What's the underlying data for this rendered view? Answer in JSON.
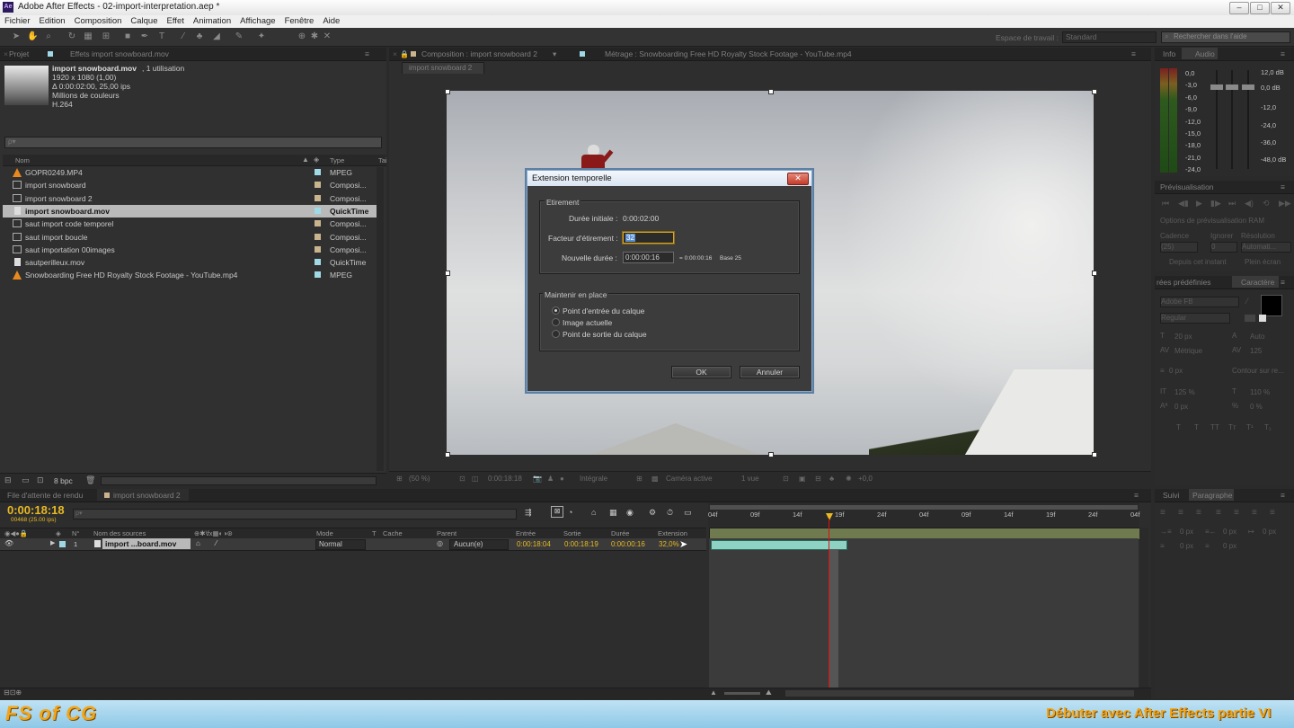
{
  "window": {
    "title": "Adobe After Effects - 02-import-interpretation.aep *",
    "logo": "Ae",
    "min": "–",
    "max": "□",
    "close": "✕"
  },
  "menu": [
    "Fichier",
    "Edition",
    "Composition",
    "Calque",
    "Effet",
    "Animation",
    "Affichage",
    "Fenêtre",
    "Aide"
  ],
  "toolbar": {
    "workspace_label": "Espace de travail :",
    "workspace_value": "Standard",
    "search_placeholder": "Rechercher dans l'aide"
  },
  "project_panel": {
    "tab_project": "Projet",
    "tab_effects": "Effets import snowboard.mov",
    "selected": {
      "name": "import snowboard.mov",
      "usage": ", 1 utilisation",
      "dims": "1920 x 1080 (1,00)",
      "duration": "Δ 0:00:02:00, 25,00 ips",
      "colors": "Millions de couleurs",
      "codec": "H.264"
    },
    "search_placeholder": "ρ▾",
    "col_name": "Nom",
    "col_type": "Type",
    "col_size": "Tai",
    "items": [
      {
        "name": "GOPR0249.MP4",
        "type": "MPEG",
        "icon": "vlc-cone-icon",
        "label": "#9fd9e6"
      },
      {
        "name": "import snowboard",
        "type": "Composi...",
        "icon": "composition-icon",
        "label": "#c9b48e"
      },
      {
        "name": "import snowboard 2",
        "type": "Composi...",
        "icon": "composition-icon",
        "label": "#c9b48e"
      },
      {
        "name": "import snowboard.mov",
        "type": "QuickTime",
        "icon": "file-icon",
        "label": "#9fd9e6"
      },
      {
        "name": "saut import  code temporel",
        "type": "Composi...",
        "icon": "composition-icon",
        "label": "#c9b48e"
      },
      {
        "name": "saut import boucle",
        "type": "Composi...",
        "icon": "composition-icon",
        "label": "#c9b48e"
      },
      {
        "name": "saut importation 00images",
        "type": "Composi...",
        "icon": "composition-icon",
        "label": "#c9b48e"
      },
      {
        "name": "sautperilleux.mov",
        "type": "QuickTime",
        "icon": "file-icon",
        "label": "#9fd9e6"
      },
      {
        "name": "Snowboarding Free HD Royalty Stock Footage - YouTube.mp4",
        "type": "MPEG",
        "icon": "vlc-cone-icon",
        "label": "#9fd9e6"
      }
    ],
    "bpc": "8 bpc"
  },
  "comp_panel": {
    "tab_comp": "Composition : import snowboard 2",
    "tab_footage": "Métrage : Snowboarding Free HD Royalty Stock Footage - YouTube.mp4",
    "subtab": "import snowboard 2",
    "zoom": "(50 %)",
    "timecode": "0:00:18:18",
    "quality": "Intégrale",
    "camera": "Caméra active",
    "views": "1 vue",
    "exposure": "+0,0"
  },
  "dialog": {
    "title": "Extension temporelle",
    "close": "✕",
    "group1": "Etirement",
    "initial_label": "Durée initiale :",
    "initial_value": "0:00:02:00",
    "factor_label": "Facteur d'étirement :",
    "factor_value": "32",
    "new_label": "Nouvelle durée :",
    "new_value": "0:00:00:16",
    "new_eq": "= 0:00:00:16",
    "new_base": "Base 25",
    "group2": "Maintenir en place",
    "radio1": "Point d'entrée du calque",
    "radio2": "Image actuelle",
    "radio3": "Point de sortie du calque",
    "ok": "OK",
    "cancel": "Annuler"
  },
  "right_panels": {
    "tab_info": "Info",
    "tab_audio": "Audio",
    "audio_left": [
      "0,0",
      "-3,0",
      "-6,0",
      "-9,0",
      "-12,0",
      "-15,0",
      "-18,0",
      "-21,0",
      "-24,0"
    ],
    "audio_right": [
      "12,0 dB",
      "0,0 dB",
      "-12,0",
      "-24,0",
      "-36,0",
      "-48,0 dB"
    ],
    "preview_tab": "Prévisualisation",
    "preview_options": "Options de prévisualisation RAM",
    "cadence": "Cadence",
    "ignore": "Ignorer",
    "resolution": "Résolution",
    "cadence_val": "(25)",
    "ignore_val": "0",
    "res_val": "Automati...",
    "from_current": "Depuis cet instant",
    "full_screen": "Plein écran",
    "tab_presets": "rées prédéfinies",
    "tab_char": "Caractère",
    "font": "Adobe FB",
    "style": "Regular",
    "font_size": "20 px",
    "leading": "Auto",
    "kerning": "Métrique",
    "tracking": "125",
    "stroke_px": "0 px",
    "stroke_type": "Contour sur re...",
    "vscale": "125 %",
    "hscale": "110 %",
    "baseline": "0 px",
    "tsume": "0 %",
    "tab_align": "Suivi",
    "tab_para": "Paragraphe"
  },
  "timeline": {
    "tab_render": "File d'attente de rendu",
    "tab_comp": "import snowboard 2",
    "timecode": "0:00:18:18",
    "frames": "00468 (25.00 ips)",
    "cols": {
      "num": "N°",
      "source": "Nom des sources",
      "mode": "Mode",
      "t": "T",
      "cache": "Cache",
      "parent": "Parent",
      "in": "Entrée",
      "out": "Sortie",
      "dur": "Durée",
      "stretch": "Extension"
    },
    "layer": {
      "num": "1",
      "name": "import ...board.mov",
      "mode": "Normal",
      "parent": "Aucun(e)",
      "in": "0:00:18:04",
      "out": "0:00:18:19",
      "dur": "0:00:00:16",
      "stretch": "32,0%"
    },
    "ruler": [
      "04f",
      "09f",
      "14f",
      "19f",
      "24f",
      "04f",
      "09f",
      "14f",
      "19f",
      "24f",
      "04f"
    ]
  },
  "banner": {
    "logo": "FS of CG",
    "title": "Débuter avec After Effects partie VI"
  }
}
